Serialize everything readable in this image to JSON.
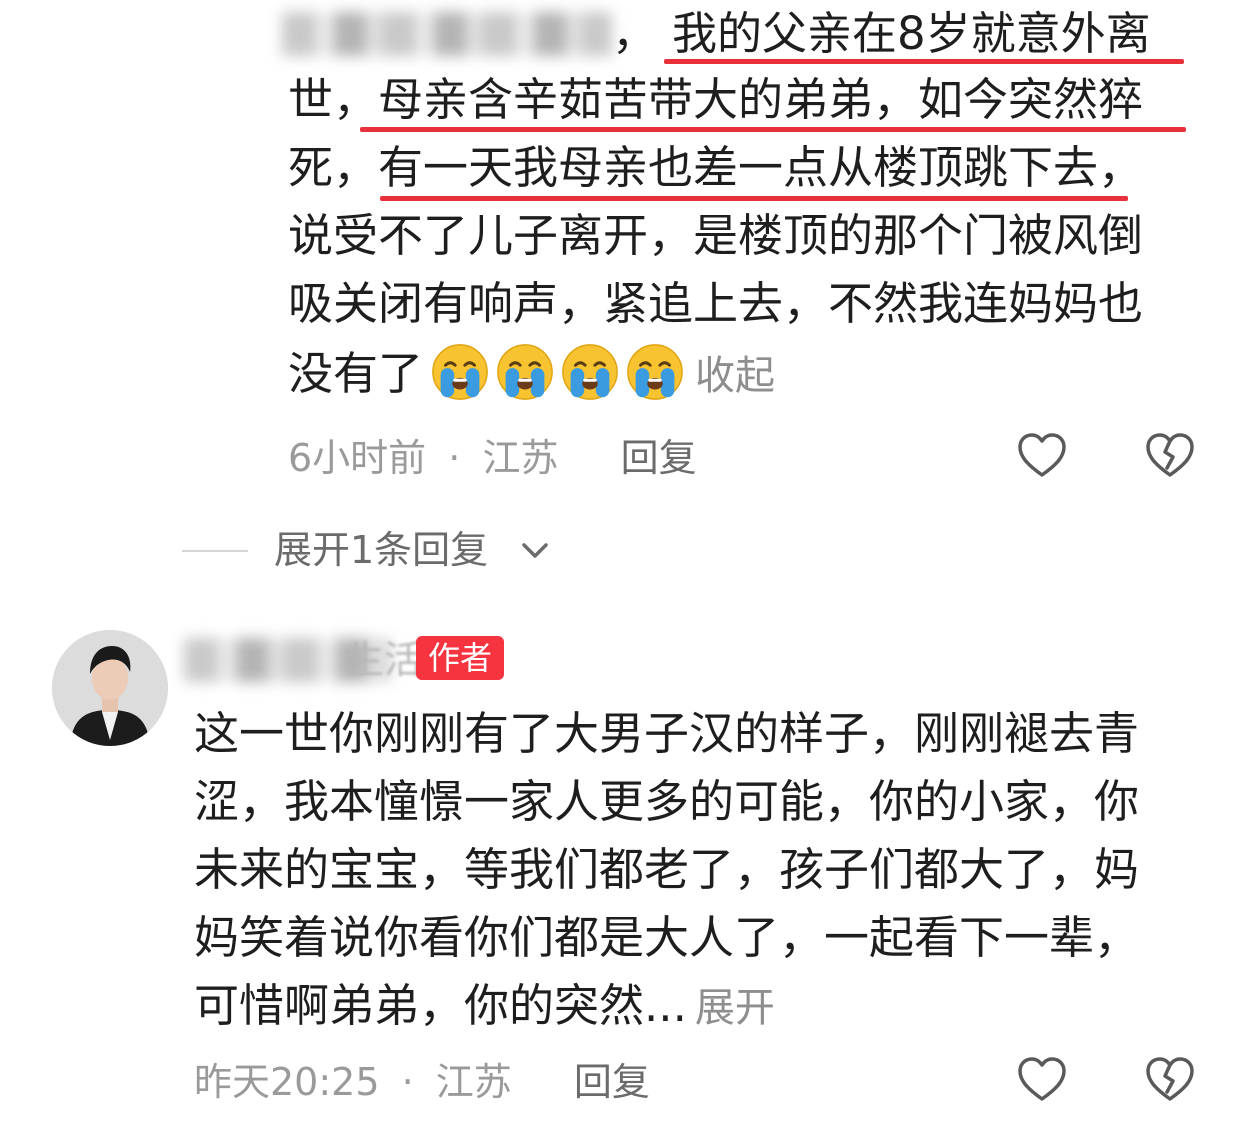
{
  "comment1": {
    "line1_visible": "我的父亲在8岁就意外离",
    "line2_prefix": "世，",
    "line2_hl": "母亲含辛茹苦带大的弟弟，如今突然猝",
    "line3_prefix": "死，",
    "line3_hl": "有一天我母亲也差一点从楼顶跳下去",
    "line3_suffix": "，",
    "line4": "说受不了儿子离开，是楼顶的那个门被风倒",
    "line5": "吸关闭有响声，紧追上去，不然我连妈妈也",
    "line6": "没有了",
    "collapse_label": "收起",
    "time": "6小时前",
    "location": "江苏",
    "reply_label": "回复",
    "emojis": [
      "crying-emoji",
      "crying-emoji",
      "crying-emoji",
      "crying-emoji"
    ],
    "line1_comma": "，"
  },
  "expand_replies": {
    "label": "展开1条回复"
  },
  "comment2": {
    "username_visible": "生活",
    "author_tag": "作者",
    "lines": [
      "这一世你刚刚有了大男子汉的样子，刚刚褪去青",
      "涩，我本憧憬一家人更多的可能，你的小家，你",
      "未来的宝宝，等我们都老了，孩子们都大了，妈",
      "妈笑着说你看你们都是大人了，一起看下一辈，"
    ],
    "last_line": "可惜啊弟弟，你的突然...",
    "expand_label": "展开",
    "time": "昨天20:25",
    "location": "江苏",
    "reply_label": "回复"
  },
  "separator_dot": "·",
  "colors": {
    "underline": "#e8303a",
    "author_tag": "#f5343f",
    "muted": "#9a9a9a"
  },
  "icons": [
    "heart-outline-icon",
    "broken-heart-icon",
    "chevron-down-icon",
    "avatar"
  ]
}
